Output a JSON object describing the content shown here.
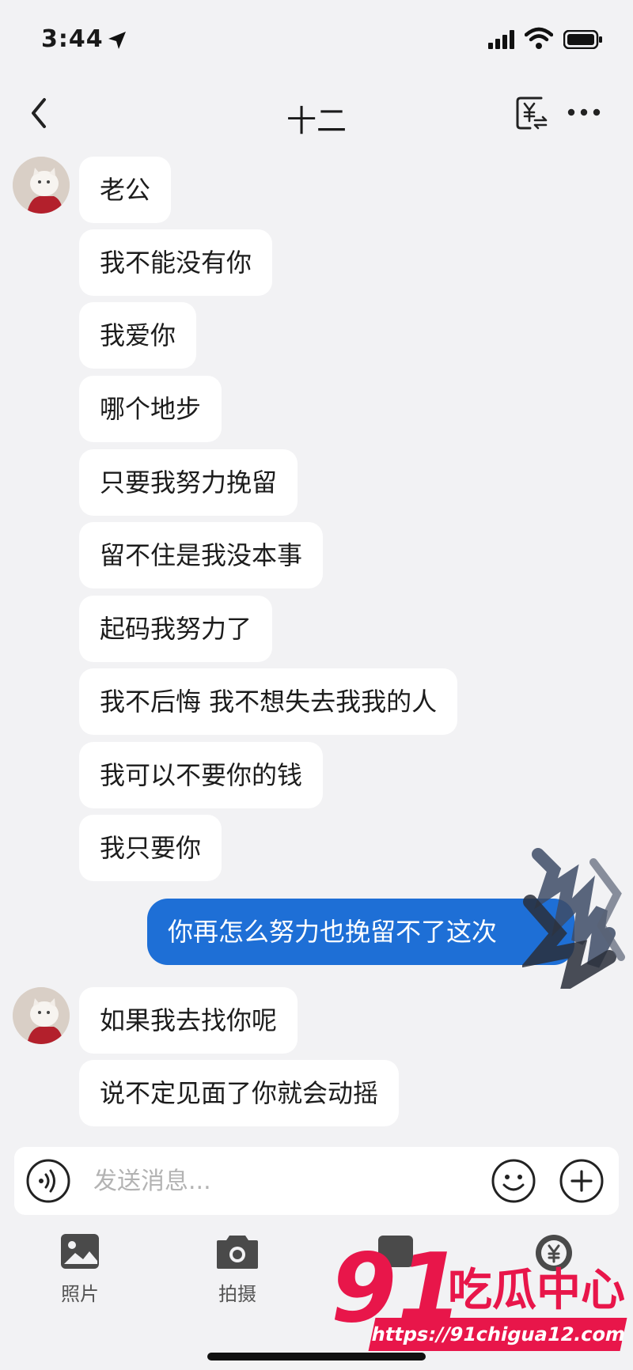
{
  "status_bar": {
    "time": "3:44"
  },
  "header": {
    "title": "十二"
  },
  "messages": [
    {
      "from": "them",
      "text": "老公"
    },
    {
      "from": "them",
      "text": "我不能没有你"
    },
    {
      "from": "them",
      "text": "我爱你"
    },
    {
      "from": "them",
      "text": "哪个地步"
    },
    {
      "from": "them",
      "text": "只要我努力挽留"
    },
    {
      "from": "them",
      "text": "留不住是我没本事"
    },
    {
      "from": "them",
      "text": "起码我努力了"
    },
    {
      "from": "them",
      "text": "我不后悔 我不想失去我我的人"
    },
    {
      "from": "them",
      "text": "我可以不要你的钱"
    },
    {
      "from": "them",
      "text": "我只要你"
    },
    {
      "from": "me",
      "text": "你再怎么努力也挽留不了这次"
    },
    {
      "from": "them",
      "text": "如果我去找你呢"
    },
    {
      "from": "them",
      "text": "说不定见面了你就会动摇"
    }
  ],
  "input": {
    "placeholder": "发送消息..."
  },
  "toolbar": {
    "photo_label": "照片",
    "camera_label": "拍摄"
  },
  "icons": [
    "location-arrow-icon",
    "signal-icon",
    "wifi-icon",
    "battery-icon",
    "back-icon",
    "transfer-money-icon",
    "more-icon",
    "voice-icon",
    "emoji-icon",
    "plus-icon",
    "photo-icon",
    "camera-icon"
  ],
  "watermark": {
    "number": "91",
    "name": "吃瓜中心",
    "url": "https://91chigua12.com"
  },
  "colors": {
    "background": "#f2f2f4",
    "my_bubble": "#1e6fd6",
    "their_bubble": "#ffffff",
    "watermark": "#e8164a"
  }
}
